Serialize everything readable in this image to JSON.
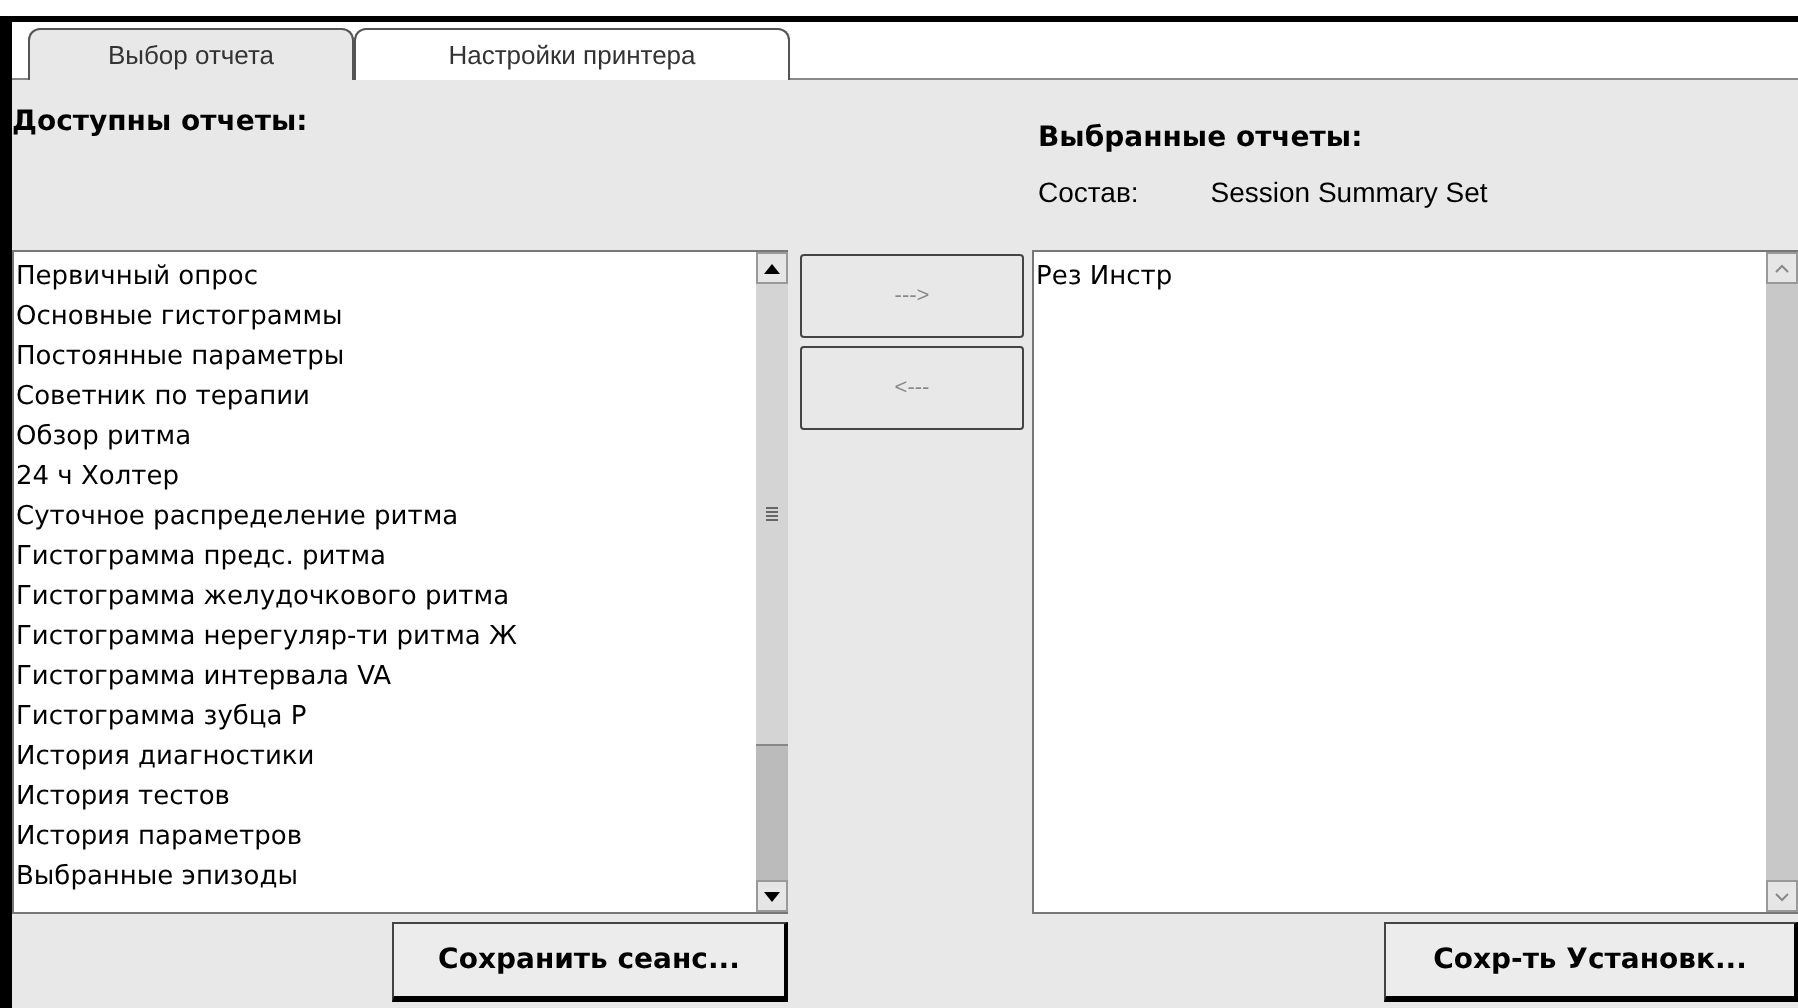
{
  "tabs": [
    {
      "label": "Выбор отчета",
      "selected": true
    },
    {
      "label": "Настройки принтера",
      "selected": false
    }
  ],
  "available": {
    "heading": "Доступны отчеты:",
    "items": [
      {
        "label": "Первичный опрос"
      },
      {
        "label": "Основные гистограммы"
      },
      {
        "label": "Постоянные параметры"
      },
      {
        "label": "Советник по терапии"
      },
      {
        "label": "Обзор ритма"
      },
      {
        "label": "24 ч Холтер"
      },
      {
        "label": "Суточное распределение ритма"
      },
      {
        "label": "Гистограмма предс. ритма"
      },
      {
        "label": "Гистограмма желудочкового ритма"
      },
      {
        "label": "Гистограмма нерегуляр-ти ритма Ж"
      },
      {
        "label": "Гистограмма интервала VA"
      },
      {
        "label": "Гистограмма зубца P"
      },
      {
        "label": "История диагностики"
      },
      {
        "label": "История тестов"
      },
      {
        "label": "История параметров"
      },
      {
        "label": "Выбранные эпизоды"
      }
    ],
    "button": "Сохранить сеанс..."
  },
  "transfer_buttons": [
    {
      "label": "--->",
      "disabled": true
    },
    {
      "label": "<---",
      "disabled": true
    }
  ],
  "selected": {
    "heading": "Выбранные отчеты:",
    "set_label": "Состав:",
    "set_value": "Session Summary Set",
    "items": [
      {
        "label": "Рез Инстр"
      }
    ],
    "button": "Сохр-ть Установк..."
  }
}
